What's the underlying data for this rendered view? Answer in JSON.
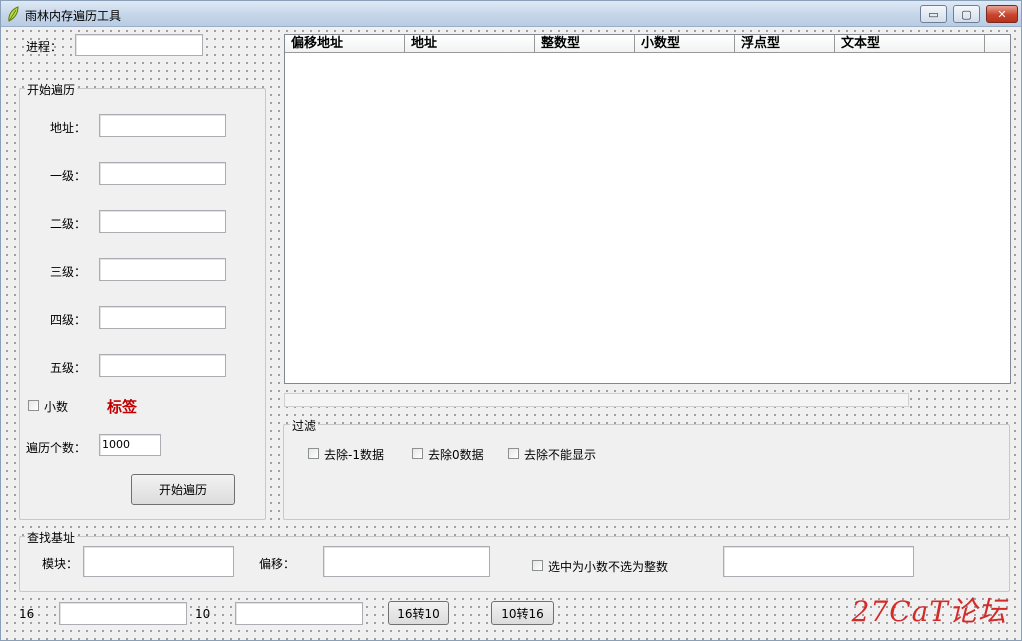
{
  "window": {
    "title": "雨林内存遍历工具",
    "buttons": {
      "minimize": "▭",
      "maximize": "▢",
      "close": "✕"
    }
  },
  "process": {
    "label": "进程：",
    "value": ""
  },
  "traverse_group": {
    "title": "开始遍历",
    "fields": [
      {
        "label": "地址：",
        "value": ""
      },
      {
        "label": "一级：",
        "value": ""
      },
      {
        "label": "二级：",
        "value": ""
      },
      {
        "label": "三级：",
        "value": ""
      },
      {
        "label": "四级：",
        "value": ""
      },
      {
        "label": "五级：",
        "value": ""
      }
    ],
    "decimal_checkbox": "小数",
    "tag_label": "标签",
    "count_label": "遍历个数：",
    "count_value": "1000",
    "start_button": "开始遍历"
  },
  "results_table": {
    "columns": [
      "偏移地址",
      "地址",
      "整数型",
      "小数型",
      "浮点型",
      "文本型"
    ],
    "rows": []
  },
  "filter_group": {
    "title": "过滤",
    "options": [
      "去除-1数据",
      "去除0数据",
      "去除不能显示"
    ]
  },
  "base_group": {
    "title": "查找基址",
    "module_label": "模块：",
    "module_value": "",
    "offset_label": "偏移：",
    "offset_value": "",
    "decimal_option": "选中为小数不选为整数",
    "result_value": ""
  },
  "converter": {
    "hex_label": "16",
    "hex_value": "",
    "dec_label": "10",
    "dec_value": "",
    "hex_to_dec_button": "16转10",
    "dec_to_hex_button": "10转16"
  },
  "watermark": "27CaT论坛",
  "colors": {
    "tag_red": "#c00000",
    "watermark_red": "#d32a2a"
  }
}
